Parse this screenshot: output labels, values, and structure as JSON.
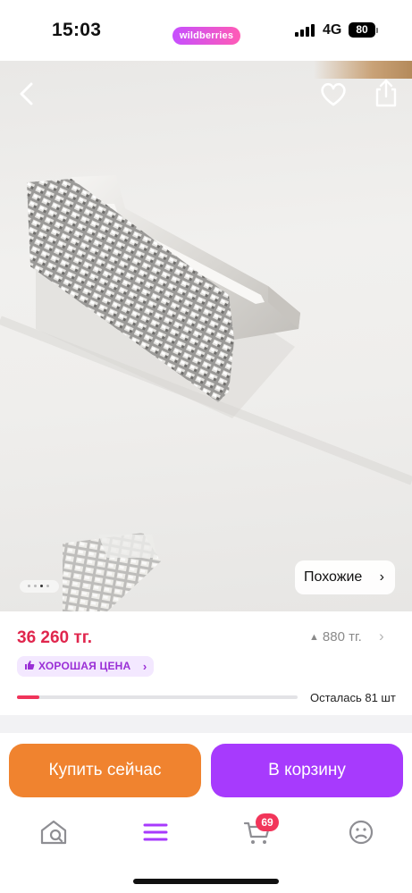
{
  "status_bar": {
    "time": "15:03",
    "brand": "wildberries",
    "network": "4G",
    "battery": "80"
  },
  "product": {
    "image_alt": "Мебельная ручка с кристаллами",
    "similar_label": "Похожие",
    "carousel": {
      "count": 4,
      "active_index": 2
    }
  },
  "price": {
    "current": "36 260 тг.",
    "diff": "880 тг.",
    "badge": "ХОРОШАЯ ЦЕНА",
    "stock_label": "Осталась 81 шт",
    "stock_fraction": 0.08
  },
  "actions": {
    "buy_now": "Купить сейчас",
    "add_to_cart": "В корзину"
  },
  "tabbar": {
    "items": [
      {
        "name": "home-icon"
      },
      {
        "name": "catalog-icon"
      },
      {
        "name": "cart-icon",
        "badge": "69"
      },
      {
        "name": "profile-icon"
      }
    ]
  },
  "colors": {
    "accent": "#a73afd",
    "buy": "#f0832f",
    "price": "#e0264d"
  }
}
